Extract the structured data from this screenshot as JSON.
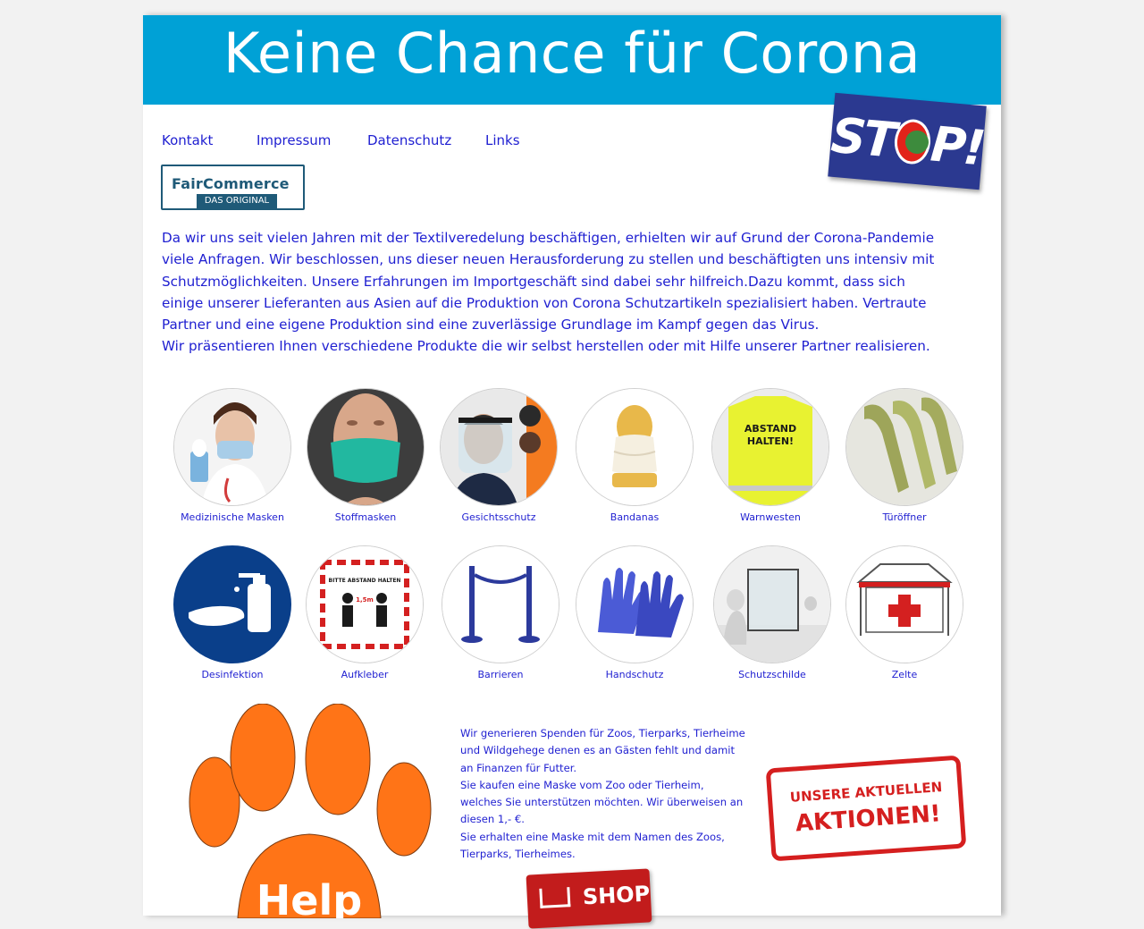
{
  "header": {
    "title": "Keine Chance für Corona"
  },
  "stop_badge": {
    "text_left": "ST",
    "text_right": "P!"
  },
  "nav": {
    "items": [
      "Kontakt",
      "Impressum",
      "Datenschutz",
      "Links"
    ]
  },
  "faircommerce_logo": {
    "name": "FairCommerce",
    "tagline": "DAS ORIGINAL"
  },
  "intro": {
    "paragraph1": "Da wir uns seit vielen Jahren mit der Textilveredelung beschäftigen, erhielten wir auf Grund der Corona-Pandemie viele Anfragen. Wir beschlossen, uns dieser neuen Herausforderung zu stellen und beschäftigten uns intensiv mit Schutzmöglichkeiten. Unsere Erfahrungen im Importgeschäft sind dabei sehr hilfreich.Dazu kommt, dass sich einige unserer Lieferanten aus Asien auf die Produktion von Corona Schutzartikeln spezialisiert haben. Vertraute Partner und eine eigene Produktion sind eine zuverlässige Grundlage im Kampf gegen das Virus.",
    "paragraph2": "Wir präsentieren Ihnen verschiedene Produkte die wir selbst herstellen oder mit Hilfe unserer Partner realisieren."
  },
  "products_row1": [
    "Medizinische Masken",
    "Stoffmasken",
    "Gesichtsschutz",
    "Bandanas",
    "Warnwesten",
    "Türöffner"
  ],
  "products_row2": [
    "Desinfektion",
    "Aufkleber",
    "Barrieren",
    "Handschutz",
    "Schutzschilde",
    "Zelte"
  ],
  "product_image_text": {
    "warnweste": "ABSTAND HALTEN!",
    "aufkleber": "BITTE ABSTAND HALTEN",
    "aufkleber_distance": "1,5m"
  },
  "paw": {
    "text": "Help"
  },
  "donation": {
    "line1": "Wir generieren Spenden für Zoos, Tierparks, Tierheime und Wildgehege denen es an Gästen fehlt und damit an Finanzen für Futter.",
    "line2": "Sie kaufen eine Maske vom Zoo oder Tierheim, welches Sie unterstützen möchten.  Wir überweisen an diesen 1,- €.",
    "line3": "Sie erhalten eine Maske mit dem Namen des Zoos, Tierparks, Tierheimes."
  },
  "stamp": {
    "line1": "UNSERE AKTUELLEN",
    "line2": "AKTIONEN!"
  },
  "shop_button": {
    "label": "SHOP"
  },
  "colors": {
    "header_bg": "#00a1d6",
    "link_blue": "#1f1fd1",
    "stop_blue": "#2b3990",
    "accent_red": "#d51f1f",
    "paw_orange": "#ff7417"
  }
}
